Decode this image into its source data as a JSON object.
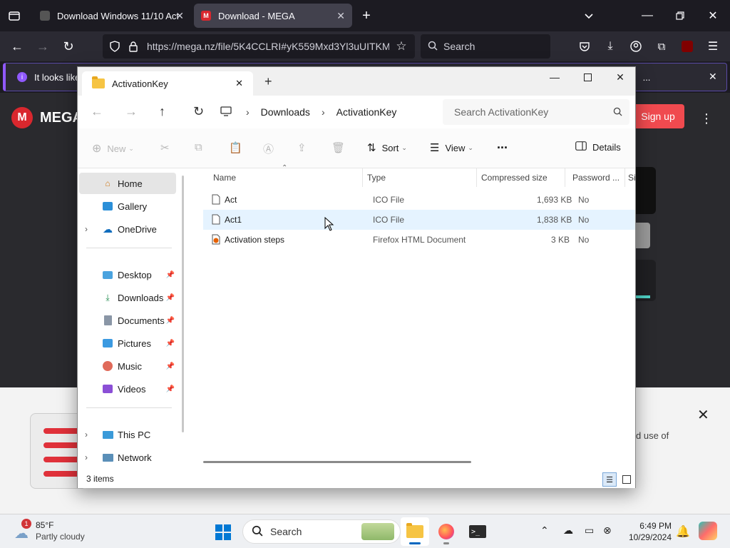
{
  "browser": {
    "tabs": [
      {
        "label": "Download Windows 11/10 Acti",
        "active": false
      },
      {
        "label": "Download - MEGA",
        "active": true
      }
    ],
    "url": "https://mega.nz/file/5K4CCLRI#yK559Mxd3Yl3uUITKM",
    "search_placeholder": "Search",
    "notification_text": "It looks like",
    "notification_more": "..."
  },
  "mega": {
    "logo_text": "MEGA",
    "signup_label": "Sign up",
    "bottom_text": "d use of"
  },
  "explorer": {
    "tab_title": "ActivationKey",
    "breadcrumbs": [
      "Downloads",
      "ActivationKey"
    ],
    "search_placeholder": "Search ActivationKey",
    "commands": {
      "new": "New",
      "sort": "Sort",
      "view": "View",
      "more": "...",
      "details": "Details"
    },
    "nav": {
      "home": "Home",
      "gallery": "Gallery",
      "onedrive": "OneDrive",
      "desktop": "Desktop",
      "downloads": "Downloads",
      "documents": "Documents",
      "pictures": "Pictures",
      "music": "Music",
      "videos": "Videos",
      "thispc": "This PC",
      "network": "Network"
    },
    "columns": {
      "name": "Name",
      "type": "Type",
      "size": "Compressed size",
      "password": "Password ...",
      "extra": "Si"
    },
    "files": [
      {
        "name": "Act",
        "type": "ICO File",
        "size": "1,693 KB",
        "password": "No"
      },
      {
        "name": "Act1",
        "type": "ICO File",
        "size": "1,838 KB",
        "password": "No"
      },
      {
        "name": "Activation steps",
        "type": "Firefox HTML Document",
        "size": "3 KB",
        "password": "No"
      }
    ],
    "status": "3 items"
  },
  "taskbar": {
    "weather_temp": "85°F",
    "weather_desc": "Partly cloudy",
    "weather_badge": "1",
    "search_label": "Search",
    "time": "6:49 PM",
    "date": "10/29/2024"
  },
  "colors": {
    "accent": "#0067c0",
    "mega_red": "#d9272e",
    "browser_dark": "#1c1b22"
  }
}
